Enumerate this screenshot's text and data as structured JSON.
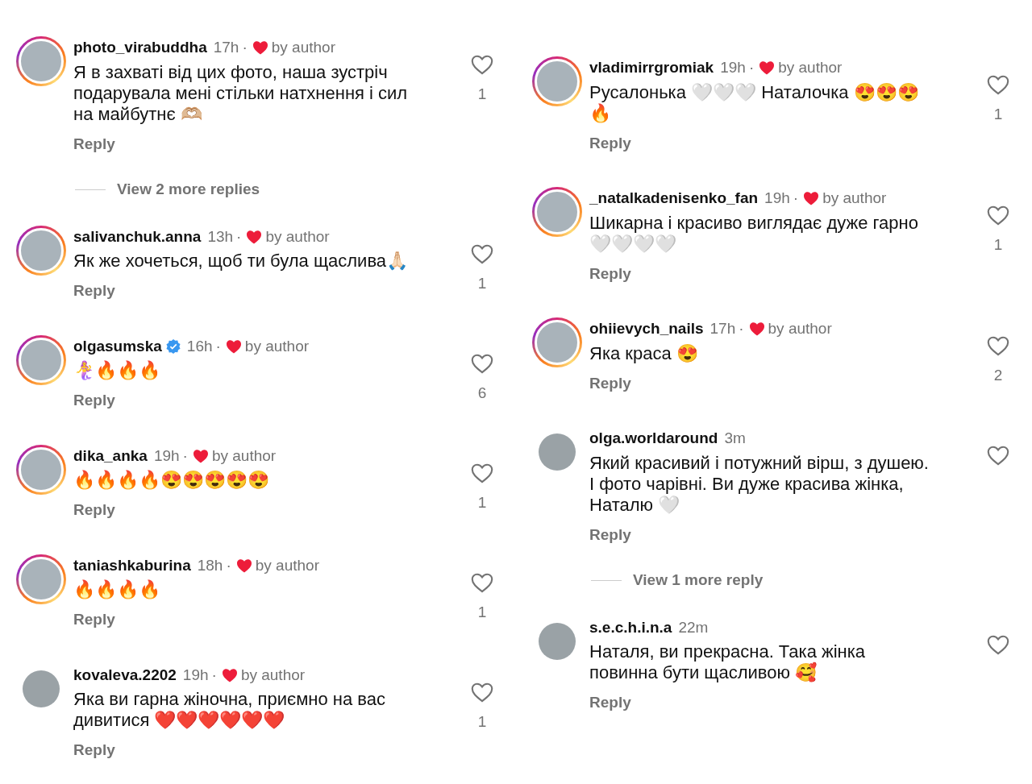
{
  "columns": [
    {
      "comments": [
        {
          "username": "photo_virabuddha",
          "verified": false,
          "time": "17h",
          "separator": "·",
          "liked_by_author": true,
          "author_label": "by author",
          "story_ring": true,
          "text": "Я в захваті від цих фото, наша зустріч подарувала мені стільки натхнення і сил на майбутнє 🫶🏼",
          "reply": "Reply",
          "likes": "1",
          "view_more": "View 2 more replies"
        },
        {
          "username": "salivanchuk.anna",
          "verified": false,
          "time": "13h",
          "separator": "·",
          "liked_by_author": true,
          "author_label": "by author",
          "story_ring": true,
          "text": "Як же хочеться, щоб ти була щаслива🙏🏻",
          "reply": "Reply",
          "likes": "1"
        },
        {
          "username": "olgasumska",
          "verified": true,
          "time": "16h",
          "separator": "·",
          "liked_by_author": true,
          "author_label": "by author",
          "story_ring": true,
          "text": "🧜‍♀️🔥🔥🔥",
          "reply": "Reply",
          "likes": "6"
        },
        {
          "username": "dika_anka",
          "verified": false,
          "time": "19h",
          "separator": "·",
          "liked_by_author": true,
          "author_label": "by author",
          "story_ring": true,
          "text": "🔥🔥🔥🔥😍😍😍😍😍",
          "reply": "Reply",
          "likes": "1"
        },
        {
          "username": "taniashkaburina",
          "verified": false,
          "time": "18h",
          "separator": "·",
          "liked_by_author": true,
          "author_label": "by author",
          "story_ring": true,
          "text": "🔥🔥🔥🔥",
          "reply": "Reply",
          "likes": "1"
        },
        {
          "username": "kovaleva.2202",
          "verified": false,
          "time": "19h",
          "separator": "·",
          "liked_by_author": true,
          "author_label": "by author",
          "story_ring": false,
          "text": "Яка ви гарна жіночна, приємно на вас дивитися ❤️❤️❤️❤️❤️❤️",
          "reply": "Reply",
          "likes": "1"
        }
      ]
    },
    {
      "comments": [
        {
          "username": "vladimirrgromiak",
          "verified": false,
          "time": "19h",
          "separator": "·",
          "liked_by_author": true,
          "author_label": "by author",
          "story_ring": true,
          "text": "Русалонька 🤍🤍🤍 Наталочка 😍😍😍 🔥",
          "reply": "Reply",
          "likes": "1"
        },
        {
          "username": "_natalkadenisenko_fan",
          "verified": false,
          "time": "19h",
          "separator": "·",
          "liked_by_author": true,
          "author_label": "by author",
          "story_ring": true,
          "text": "Шикарна і красиво виглядає дуже гарно 🤍🤍🤍🤍",
          "reply": "Reply",
          "likes": "1"
        },
        {
          "username": "ohiievych_nails",
          "verified": false,
          "time": "17h",
          "separator": "·",
          "liked_by_author": true,
          "author_label": "by author",
          "story_ring": true,
          "text": "Яка краса 😍",
          "reply": "Reply",
          "likes": "2"
        },
        {
          "username": "olga.worldaround",
          "verified": false,
          "time": "3m",
          "liked_by_author": false,
          "story_ring": false,
          "text": "Який красивий і потужний вірш, з душею. І фото чарівні. Ви дуже красива жінка, Наталю 🤍",
          "reply": "Reply",
          "view_more": "View 1 more reply"
        },
        {
          "username": "s.e.c.h.i.n.a",
          "verified": false,
          "time": "22m",
          "liked_by_author": false,
          "story_ring": false,
          "text": "Наталя, ви прекрасна. Така жінка повинна бути щасливою 🥰",
          "reply": "Reply"
        }
      ]
    }
  ]
}
